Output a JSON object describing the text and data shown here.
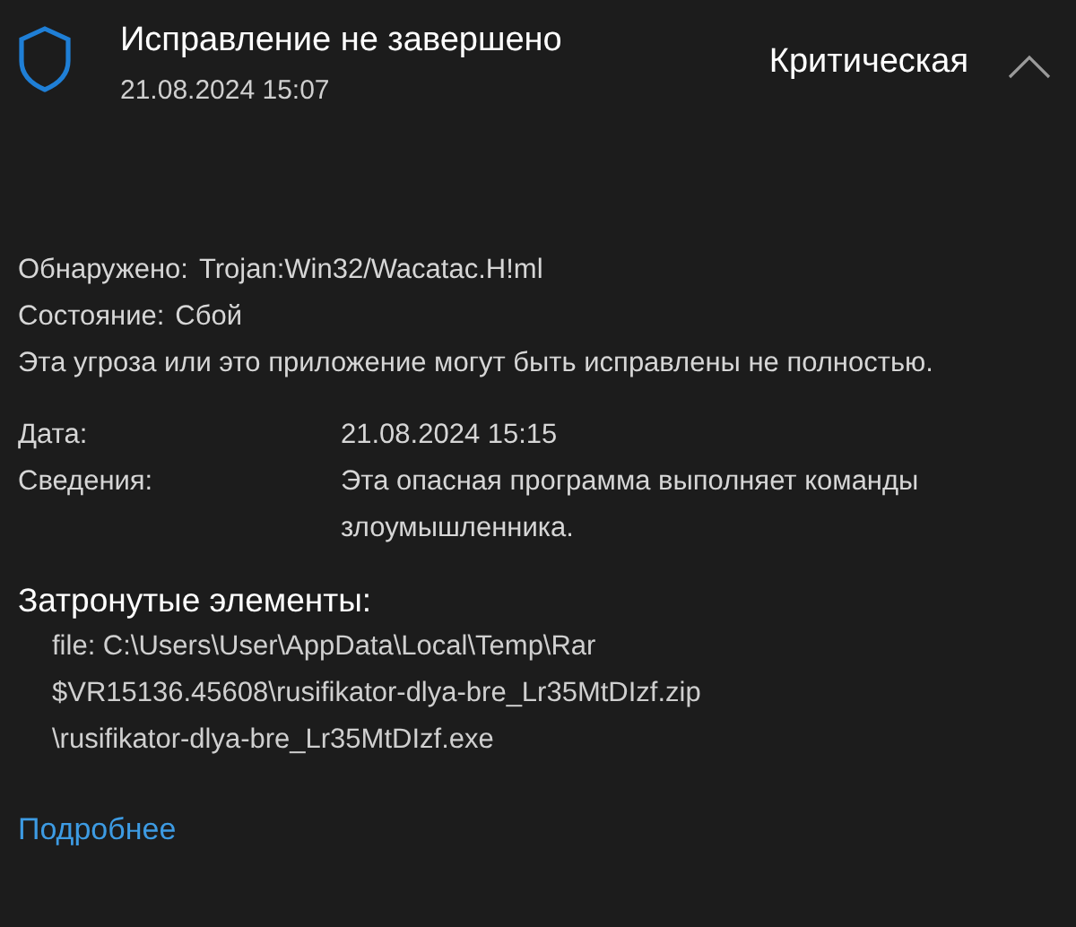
{
  "header": {
    "title": "Исправление не завершено",
    "time": "21.08.2024 15:07",
    "severity": "Критическая",
    "expanded": true
  },
  "threat": [
    {
      "label": "Обнаружено:",
      "value": "Trojan:Win32/Wacatac.H!ml"
    },
    {
      "label": "Состояние:",
      "value": "Сбой"
    }
  ],
  "warning": "Эта угроза или это приложение могут быть исправлены не полностью.",
  "details": [
    {
      "label": "Дата:",
      "value": "21.08.2024 15:15"
    },
    {
      "label": "Сведения:",
      "value": "Эта опасная программа выполняет команды злоумышленника."
    }
  ],
  "affected": {
    "heading": "Затронутые элементы:",
    "lines": [
      "file: C:\\Users\\User\\AppData\\Local\\Temp\\Rar",
      "$VR15136.45608\\rusifikator-dlya-bre_Lr35MtDIzf.zip",
      "\\rusifikator-dlya-bre_Lr35MtDIzf.exe"
    ]
  },
  "link": "Подробнее"
}
